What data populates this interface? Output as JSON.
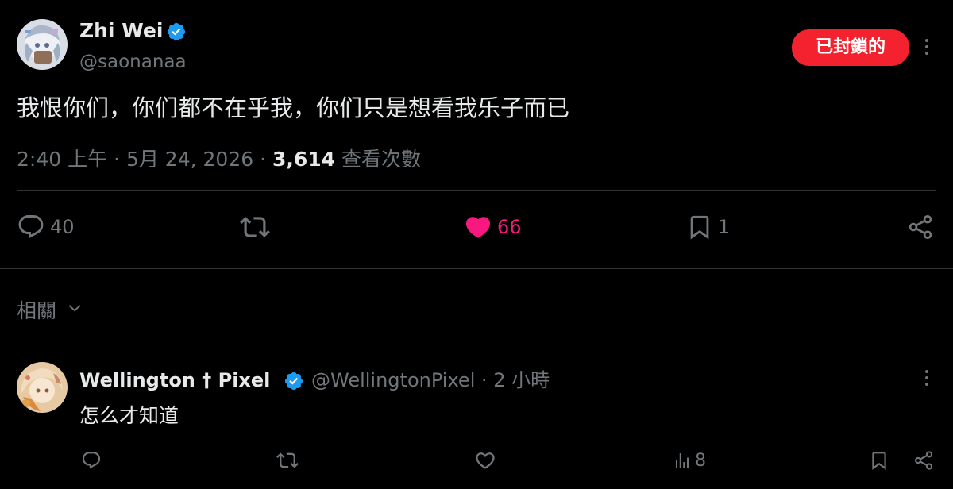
{
  "main_tweet": {
    "author_name": "Zhi Wei",
    "author_handle": "@saonanaa",
    "verified": true,
    "blocked_button_label": "已封鎖的",
    "more_icon": "more-vertical-icon",
    "text": "我恨你们，你们都不在乎我，你们只是想看我乐子而已",
    "time": "2:40 上午",
    "separator": "·",
    "date": "5月 24, 2026",
    "views_count": "3,614",
    "views_label": "查看次數",
    "actions": {
      "reply": {
        "icon": "reply-icon",
        "count": "40"
      },
      "retweet": {
        "icon": "retweet-icon"
      },
      "like": {
        "icon": "heart-filled-icon",
        "count": "66",
        "liked": true
      },
      "bookmark": {
        "icon": "bookmark-icon",
        "count": "1"
      },
      "share": {
        "icon": "share-icon"
      }
    }
  },
  "related": {
    "label": "相關",
    "icon": "chevron-down-icon"
  },
  "reply_tweet": {
    "author_name": "Wellington † Pixel",
    "verified": true,
    "author_handle": "@WellingtonPixel",
    "separator": "·",
    "time": "2 小時",
    "more_icon": "more-vertical-icon",
    "text": "怎么才知道",
    "actions": {
      "reply": {
        "icon": "reply-icon"
      },
      "retweet": {
        "icon": "retweet-icon"
      },
      "like": {
        "icon": "heart-outline-icon"
      },
      "views": {
        "icon": "analytics-icon",
        "count": "8"
      },
      "bookmark": {
        "icon": "bookmark-icon"
      },
      "share": {
        "icon": "share-icon"
      }
    }
  },
  "colors": {
    "background": "#000000",
    "primary_text": "#e7e9ea",
    "secondary_text": "#71767b",
    "divider": "#2f3336",
    "verified_blue": "#1d9bf0",
    "blocked_red": "#f4212e",
    "like_pink": "#f91880"
  }
}
